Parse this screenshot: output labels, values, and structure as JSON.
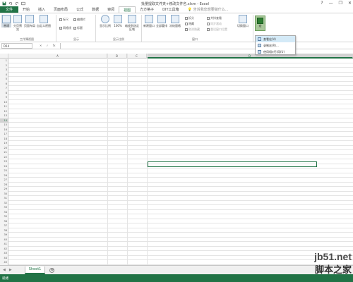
{
  "window": {
    "title": "批量提取文件夹+修改文件名.xlsm - Excel",
    "help": "?",
    "minimize": "—",
    "restore": "❐",
    "close": "✕"
  },
  "tabs": [
    {
      "label": "文件"
    },
    {
      "label": "开始"
    },
    {
      "label": "插入"
    },
    {
      "label": "页面布局"
    },
    {
      "label": "公式"
    },
    {
      "label": "数据"
    },
    {
      "label": "审阅"
    },
    {
      "label": "视图"
    },
    {
      "label": "方方格子"
    },
    {
      "label": "DIY工具箱"
    }
  ],
  "tell_me": "告诉我您想要做什么...",
  "ribbon": {
    "workbook_views": {
      "normal": "普通",
      "page_break": "分页预览",
      "page_layout": "页面布局",
      "custom": "自定义视图",
      "label": "工作簿视图"
    },
    "show": {
      "ruler": "标尺",
      "formula_bar": "编辑栏",
      "gridlines": "网格线",
      "headings": "标题",
      "label": "显示"
    },
    "zoom": {
      "zoom": "显示比例",
      "hundred": "100%",
      "to_selection": "缩放到选定区域",
      "label": "显示比例"
    },
    "window": {
      "new_window": "新建窗口",
      "arrange_all": "全部重排",
      "freeze": "冻结窗格",
      "split": "拆分",
      "hide": "隐藏",
      "unhide": "取消隐藏",
      "side_by_side": "并排查看",
      "sync_scroll": "同步滚动",
      "reset_pos": "重设窗口位置",
      "switch": "切换窗口",
      "label": "窗口"
    },
    "macros": {
      "label": "宏"
    }
  },
  "macro_menu": [
    {
      "label": "查看宏(V)"
    },
    {
      "label": "录制宏(R)..."
    },
    {
      "label": "使用相对引用(U)"
    }
  ],
  "formula_bar": {
    "name_box": "D14",
    "cancel": "✕",
    "enter": "✓",
    "fx": "fx"
  },
  "columns": [
    {
      "label": ""
    },
    {
      "label": "A"
    },
    {
      "label": "B"
    },
    {
      "label": "C"
    },
    {
      "label": "D"
    }
  ],
  "rows": [
    "1",
    "2",
    "3",
    "4",
    "5",
    "6",
    "7",
    "8",
    "9",
    "10",
    "11",
    "12",
    "13",
    "14",
    "15",
    "16",
    "17",
    "18",
    "19",
    "20",
    "21",
    "22",
    "23",
    "24",
    "25",
    "26",
    "27",
    "28",
    "29",
    "30",
    "31",
    "32",
    "33",
    "34",
    "35",
    "36",
    "37",
    "38",
    "39",
    "40",
    "41",
    "42",
    "43",
    "44",
    "45"
  ],
  "active_cell": "D14",
  "sheet_tabs": [
    {
      "label": "Sheet1"
    }
  ],
  "add_sheet": "⊕",
  "status": "就绪",
  "watermark": {
    "top": "jb51.net",
    "bottom": "脚本之家"
  },
  "colors": {
    "accent": "#217346",
    "header_bg": "#f3f3f3"
  }
}
